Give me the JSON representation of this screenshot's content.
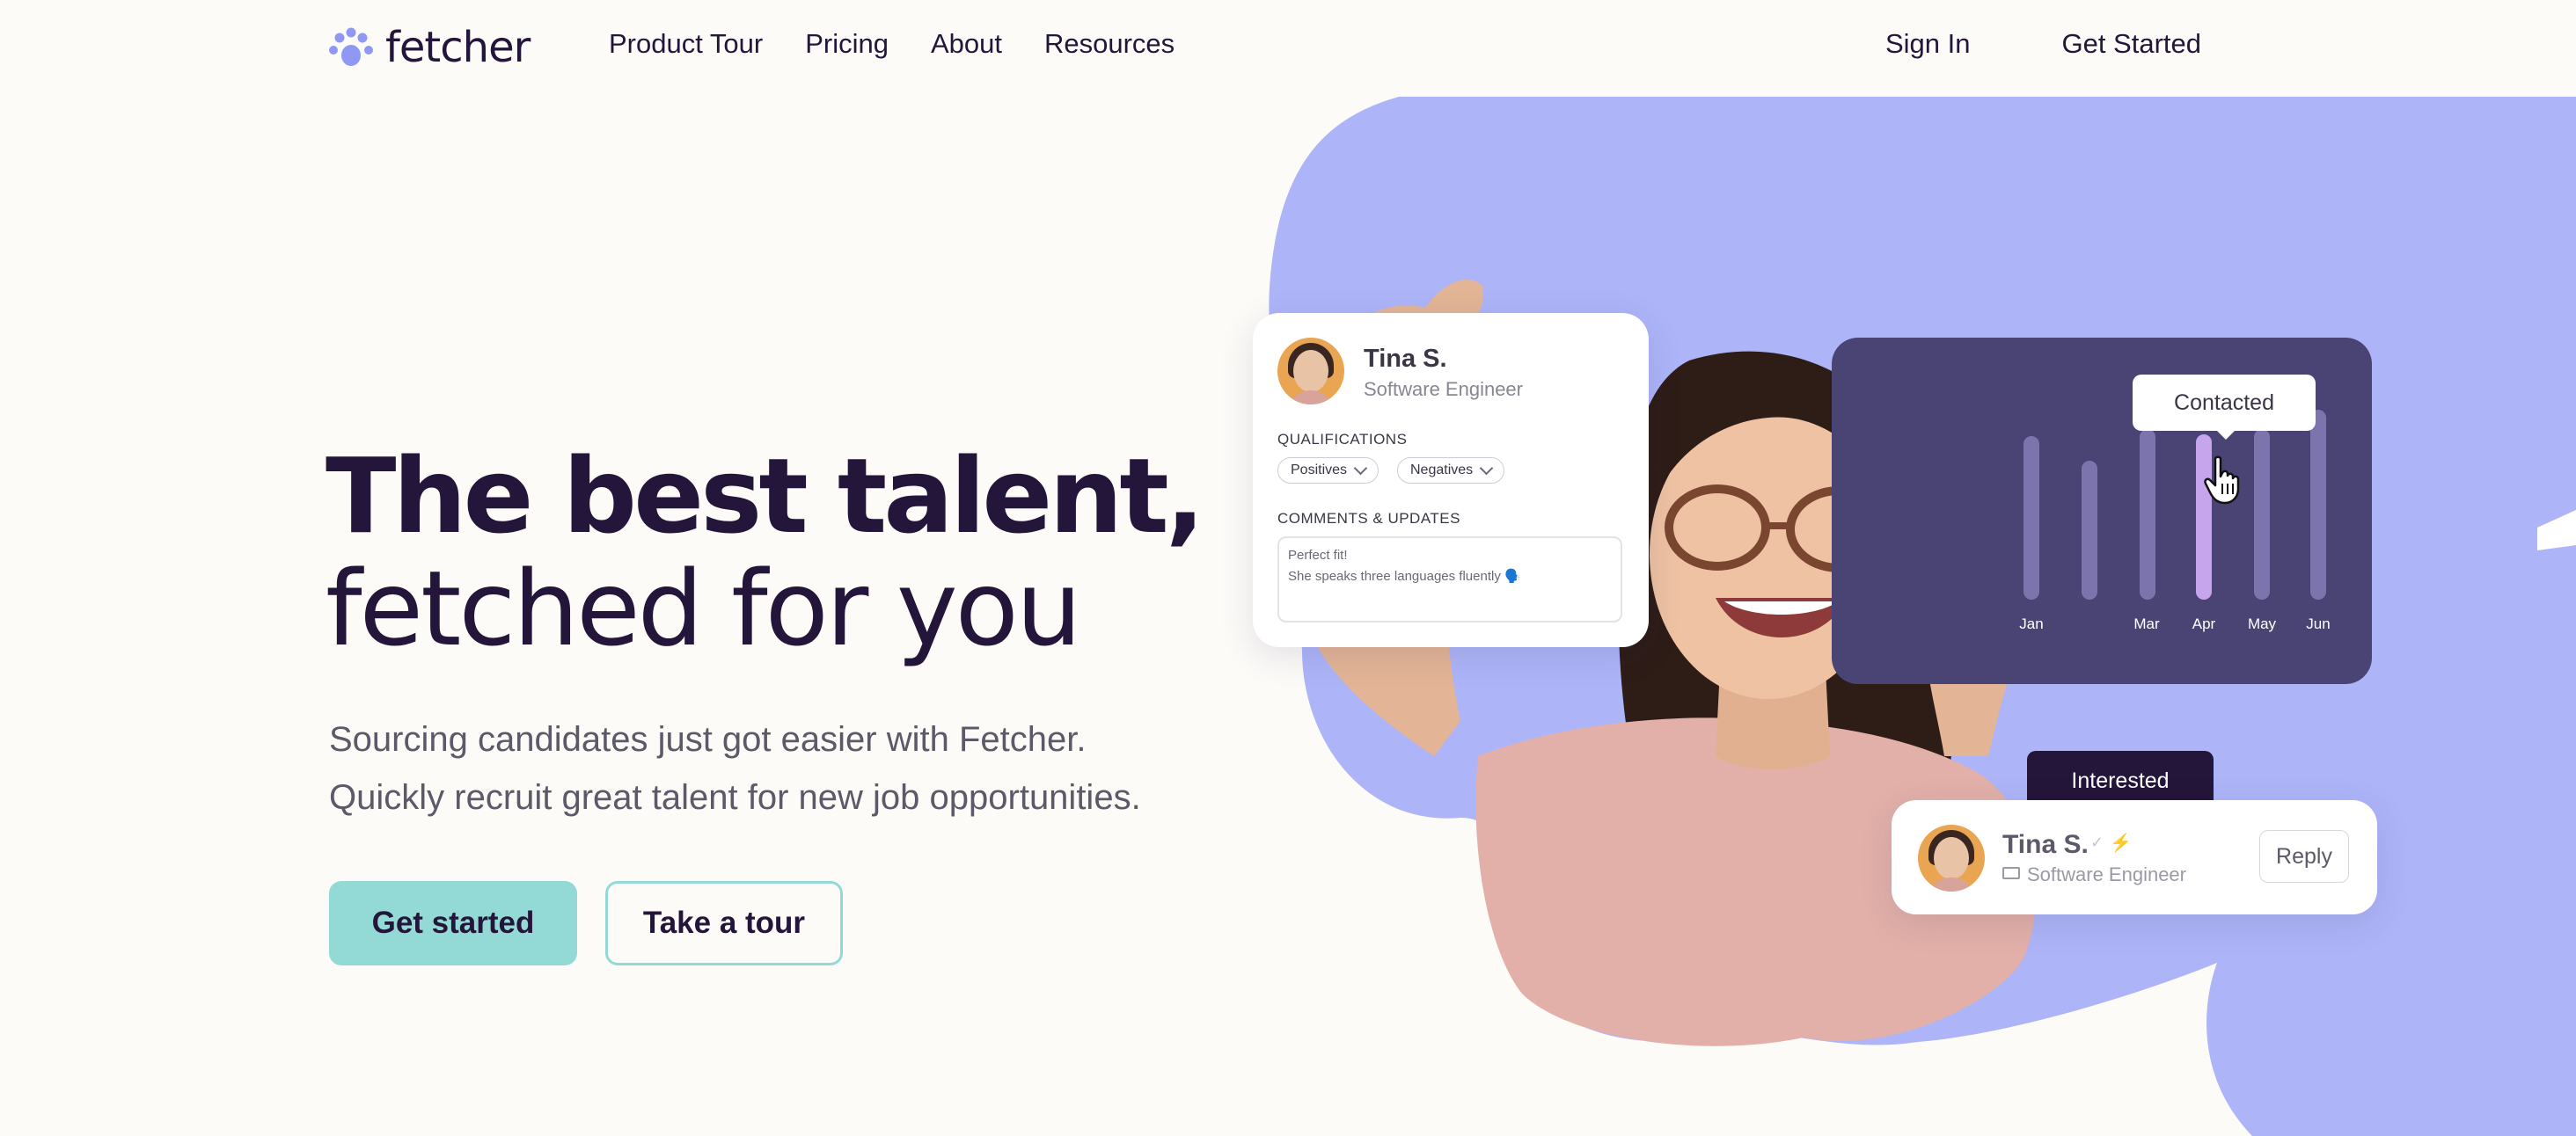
{
  "header": {
    "logo_text": "fetcher",
    "nav": [
      {
        "label": "Product Tour"
      },
      {
        "label": "Pricing"
      },
      {
        "label": "About"
      },
      {
        "label": "Resources"
      }
    ],
    "sign_in": "Sign In",
    "get_started": "Get Started"
  },
  "hero": {
    "title_line1": "The best talent,",
    "title_line2": "fetched for you",
    "subtitle_line1": "Sourcing candidates just got easier with Fetcher.",
    "subtitle_line2": "Quickly recruit great talent for new job opportunities.",
    "primary_button": "Get started",
    "secondary_button": "Take a tour"
  },
  "profile_card": {
    "name": "Tina S.",
    "role": "Software Engineer",
    "qualifications_label": "QUALIFICATIONS",
    "positives_label": "Positives",
    "negatives_label": "Negatives",
    "comments_label": "COMMENTS & UPDATES",
    "comment_line1": "Perfect fit!",
    "comment_line2": "She speaks three languages fluently 🗣️"
  },
  "chart_card": {
    "tooltip": "Contacted",
    "ticks": [
      "Jan",
      "Mar",
      "Apr",
      "May",
      "Jun"
    ]
  },
  "reply_card": {
    "status": "Interested",
    "name": "Tina S.",
    "check_glyph": "✓",
    "spark_glyph": "⚡",
    "role": "Software Engineer",
    "reply_button": "Reply"
  },
  "colors": {
    "background": "#fcfbf8",
    "text_dark": "#24153a",
    "accent_teal": "#93dad6",
    "blob_lavender": "#adb5f8",
    "chart_purple": "#4a4474",
    "bar_highlight": "#c7a5ec",
    "avatar_orange": "#eaa552"
  },
  "icons": {
    "logo": "paw-print-icon",
    "cursor": "hand-pointer-icon",
    "dropdown": "chevron-down-icon",
    "verified": "check-icon",
    "spark": "lightning-icon",
    "folder": "folder-icon"
  }
}
